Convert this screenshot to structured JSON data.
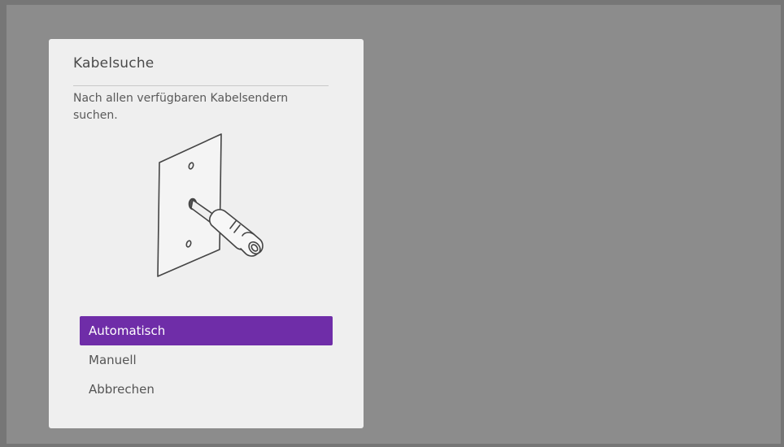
{
  "dialog": {
    "title": "Kabelsuche",
    "description": "Nach allen verfügbaren Kabelsendern suchen.",
    "illustration_icon": "coax-wall-socket-icon"
  },
  "menu": {
    "items": [
      {
        "label": "Automatisch",
        "selected": true
      },
      {
        "label": "Manuell",
        "selected": false
      },
      {
        "label": "Abbrechen",
        "selected": false
      }
    ]
  },
  "colors": {
    "background": "#8c8c8c",
    "panel": "#efefef",
    "accent": "#6f2da8"
  }
}
